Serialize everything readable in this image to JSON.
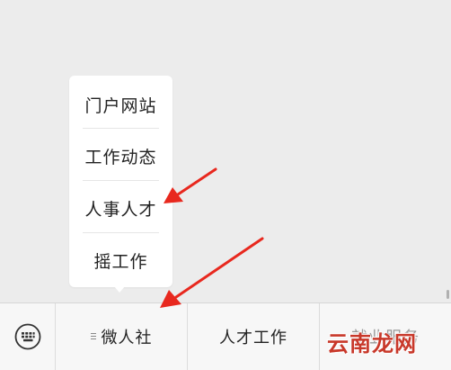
{
  "popup_menu": {
    "items": [
      {
        "label": "门户网站"
      },
      {
        "label": "工作动态"
      },
      {
        "label": "人事人才"
      },
      {
        "label": "摇工作"
      }
    ]
  },
  "menu_bar": {
    "keyboard_icon": "keyboard-icon",
    "tabs": [
      {
        "label": "微人社",
        "icon": "submenu-icon"
      },
      {
        "label": "人才工作"
      },
      {
        "label": "就业服务"
      }
    ]
  },
  "watermark": {
    "text": "云南龙网"
  },
  "colors": {
    "background": "#ececec",
    "menu_bar": "#f7f7f7",
    "annotation_arrow": "#e8281e",
    "watermark": "#c8382a"
  }
}
